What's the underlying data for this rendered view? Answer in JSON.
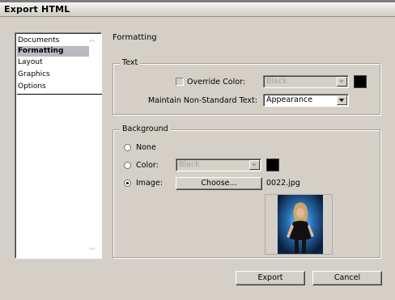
{
  "window": {
    "title": "Export HTML"
  },
  "sidebar": {
    "items": [
      {
        "label": "Documents",
        "selected": false
      },
      {
        "label": "Formatting",
        "selected": true
      },
      {
        "label": "Layout",
        "selected": false
      },
      {
        "label": "Graphics",
        "selected": false
      },
      {
        "label": "Options",
        "selected": false
      }
    ]
  },
  "section": {
    "title": "Formatting"
  },
  "text_group": {
    "legend": "Text",
    "override_color_label": "Override Color:",
    "override_color_checked": false,
    "override_color_value": "Black",
    "override_swatch_color": "#000000",
    "maintain_label": "Maintain Non-Standard Text:",
    "maintain_value": "Appearance"
  },
  "background_group": {
    "legend": "Background",
    "none_label": "None",
    "color_label": "Color:",
    "color_value": "Black",
    "color_swatch_color": "#000000",
    "image_label": "Image:",
    "selected_option": "image",
    "choose_button": "Choose...",
    "image_filename": "0022.jpg"
  },
  "footer": {
    "export_button": "Export",
    "cancel_button": "Cancel"
  }
}
